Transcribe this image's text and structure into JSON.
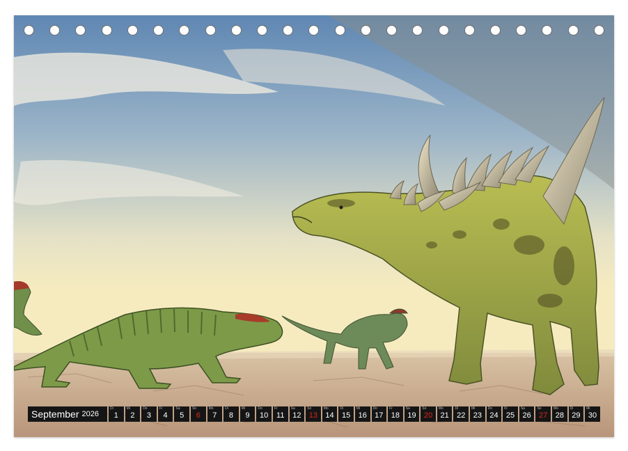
{
  "calendar": {
    "month": "September",
    "year": "2026",
    "days": [
      {
        "wd": "Di",
        "num": "1"
      },
      {
        "wd": "Mi",
        "num": "2"
      },
      {
        "wd": "Do",
        "num": "3"
      },
      {
        "wd": "Fr",
        "num": "4"
      },
      {
        "wd": "Sa",
        "num": "5"
      },
      {
        "wd": "So",
        "num": "6",
        "sunday": true
      },
      {
        "wd": "Mo",
        "num": "7"
      },
      {
        "wd": "Di",
        "num": "8"
      },
      {
        "wd": "Mi",
        "num": "9"
      },
      {
        "wd": "Do",
        "num": "10"
      },
      {
        "wd": "Fr",
        "num": "11"
      },
      {
        "wd": "Sa",
        "num": "12"
      },
      {
        "wd": "So",
        "num": "13",
        "sunday": true
      },
      {
        "wd": "Mo",
        "num": "14"
      },
      {
        "wd": "Di",
        "num": "15"
      },
      {
        "wd": "Mi",
        "num": "16"
      },
      {
        "wd": "Do",
        "num": "17"
      },
      {
        "wd": "Fr",
        "num": "18"
      },
      {
        "wd": "Sa",
        "num": "19"
      },
      {
        "wd": "So",
        "num": "20",
        "sunday": true
      },
      {
        "wd": "Mo",
        "num": "21"
      },
      {
        "wd": "Di",
        "num": "22"
      },
      {
        "wd": "Mi",
        "num": "23"
      },
      {
        "wd": "Do",
        "num": "24"
      },
      {
        "wd": "Fr",
        "num": "25"
      },
      {
        "wd": "Sa",
        "num": "26"
      },
      {
        "wd": "So",
        "num": "27",
        "sunday": true
      },
      {
        "wd": "Mo",
        "num": "28"
      },
      {
        "wd": "Di",
        "num": "29"
      },
      {
        "wd": "Mi",
        "num": "30"
      }
    ]
  },
  "binding_holes": 23,
  "colors": {
    "day_box": "#151515",
    "day_number": "#ffffff",
    "sunday_number": "#e0261c",
    "sky_top": "#6f95bd",
    "sky_horizon": "#f6ecc4",
    "ground": "#c6a88a"
  }
}
